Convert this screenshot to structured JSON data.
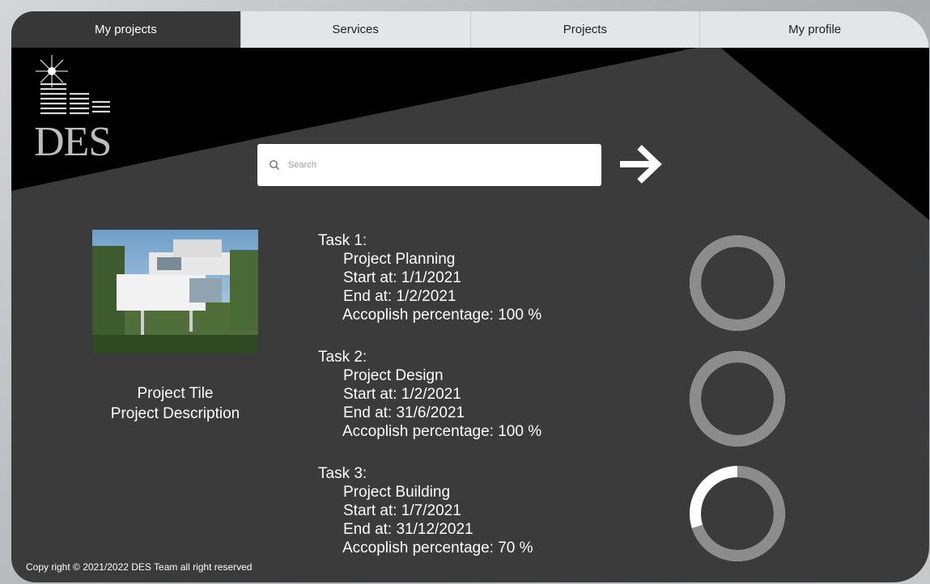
{
  "nav": {
    "items": [
      {
        "label": "My projects",
        "active": true
      },
      {
        "label": "Services",
        "active": false
      },
      {
        "label": "Projects",
        "active": false
      },
      {
        "label": "My profile",
        "active": false
      }
    ]
  },
  "logo": {
    "text": "DES",
    "icon": "building-logo-icon"
  },
  "search": {
    "placeholder": "Search",
    "value": ""
  },
  "project": {
    "image": "building-photo",
    "title": "Project Tile",
    "description": "Project Description"
  },
  "tasks": [
    {
      "heading": "Task 1:",
      "name": "Project Planning",
      "start": "Start at: 1/1/2021",
      "end": "End at: 1/2/2021",
      "percentage_text": "Accoplish percentage: 100 %",
      "progress": 100
    },
    {
      "heading": "Task 2:",
      "name": "Project Design",
      "start": "Start at: 1/2/2021",
      "end": "End at:  31/6/2021",
      "percentage_text": "Accoplish percentage: 100 %",
      "progress": 100
    },
    {
      "heading": "Task 3:",
      "name": "Project Building",
      "start": "Start at: 1/7/2021",
      "end": "End at:  31/12/2021",
      "percentage_text": "Accoplish percentage: 70 %",
      "progress": 70
    }
  ],
  "footer": {
    "text": "Copy right © 2021/2022  DES Team all right reserved"
  },
  "colors": {
    "background": "#3b3b3b",
    "header_black": "#000000",
    "ring_track": "#ffffff",
    "ring_fill": "#8c8c8c",
    "nav_inactive": "#e3e5e8",
    "nav_active": "#373737"
  }
}
